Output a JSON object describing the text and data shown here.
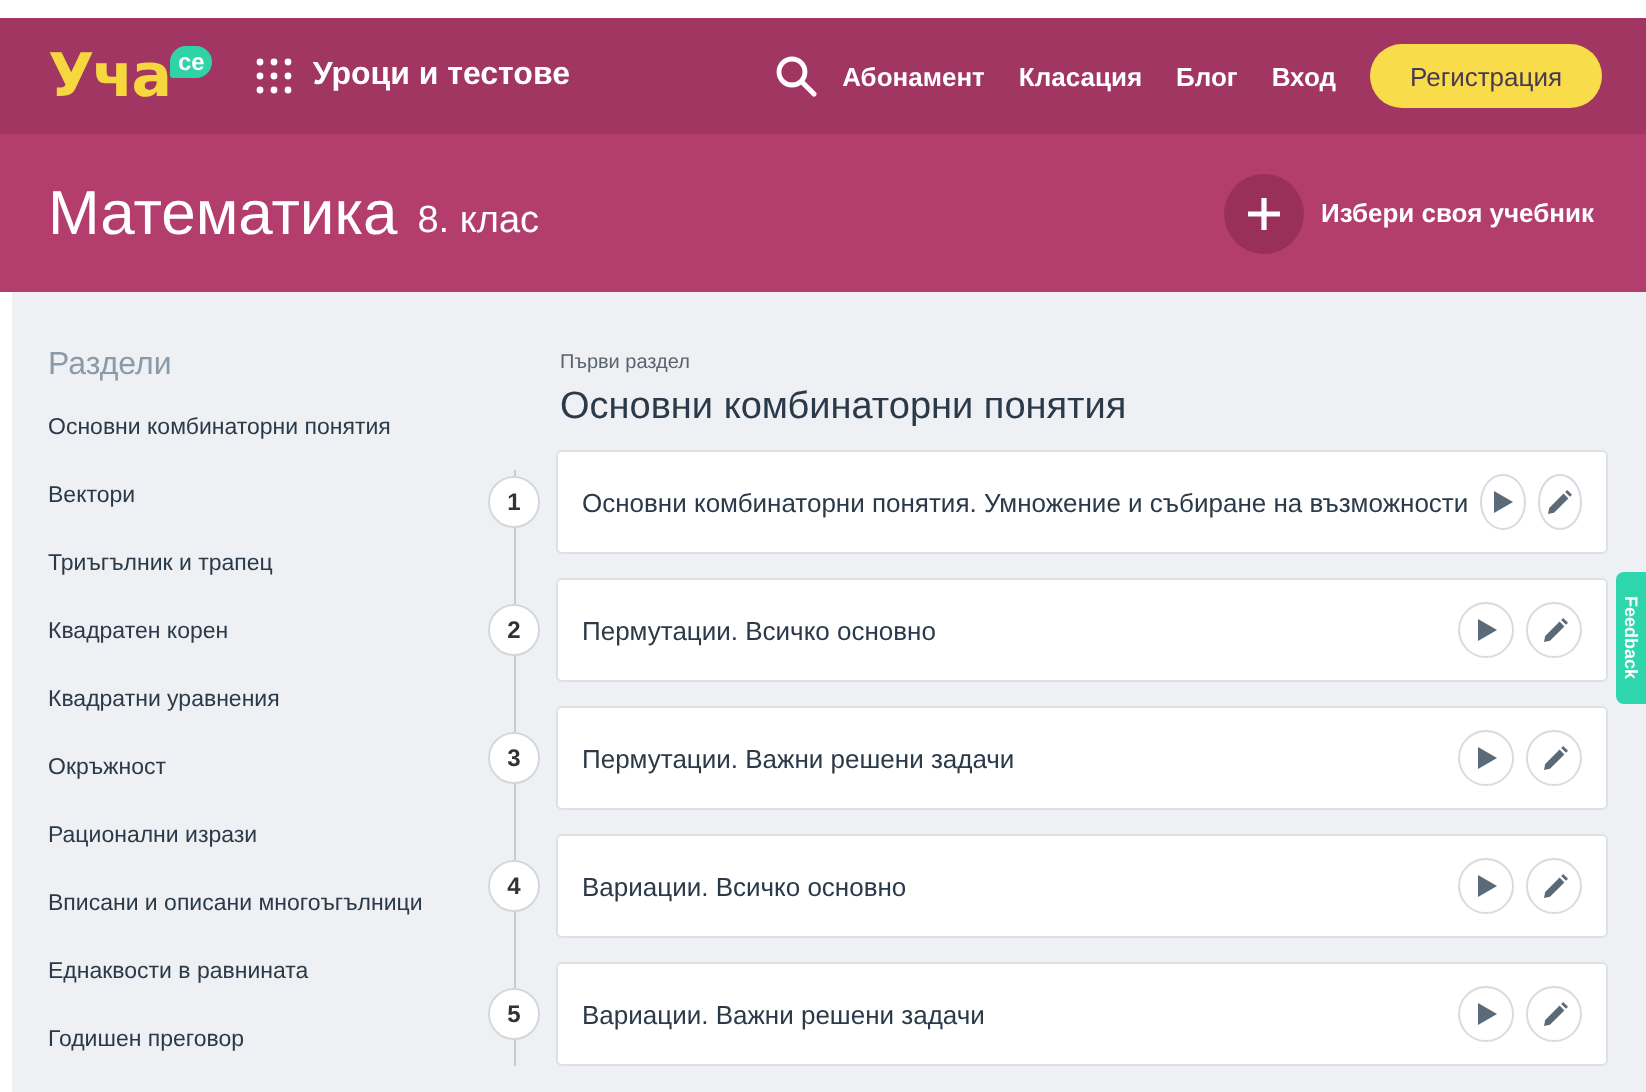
{
  "logo": {
    "text": "Уча",
    "badge": "се"
  },
  "nav": {
    "menu_label": "Уроци и тестове",
    "links": [
      "Абонамент",
      "Класация",
      "Блог",
      "Вход"
    ],
    "register": "Регистрация"
  },
  "subject": {
    "title": "Математика",
    "grade": "8. клас",
    "choose_book": "Избери своя учебник"
  },
  "sidebar": {
    "title": "Раздели",
    "items": [
      "Основни комбинаторни понятия",
      "Вектори",
      "Триъгълник и трапец",
      "Квадратен корен",
      "Квадратни уравнения",
      "Окръжност",
      "Рационални изрази",
      "Вписани и описани многоъгълници",
      "Еднаквости в равнината",
      "Годишен преговор"
    ]
  },
  "section": {
    "kicker": "Първи раздел",
    "title": "Основни комбинаторни понятия",
    "lessons": [
      {
        "number": "1",
        "title": "Основни комбинаторни понятия. Умножение и събиране на възможности"
      },
      {
        "number": "2",
        "title": "Пермутации. Всичко основно"
      },
      {
        "number": "3",
        "title": "Пермутации. Важни решени задачи"
      },
      {
        "number": "4",
        "title": "Вариации. Всичко основно"
      },
      {
        "number": "5",
        "title": "Вариации. Важни решени задачи"
      }
    ]
  },
  "feedback": "Feedback"
}
